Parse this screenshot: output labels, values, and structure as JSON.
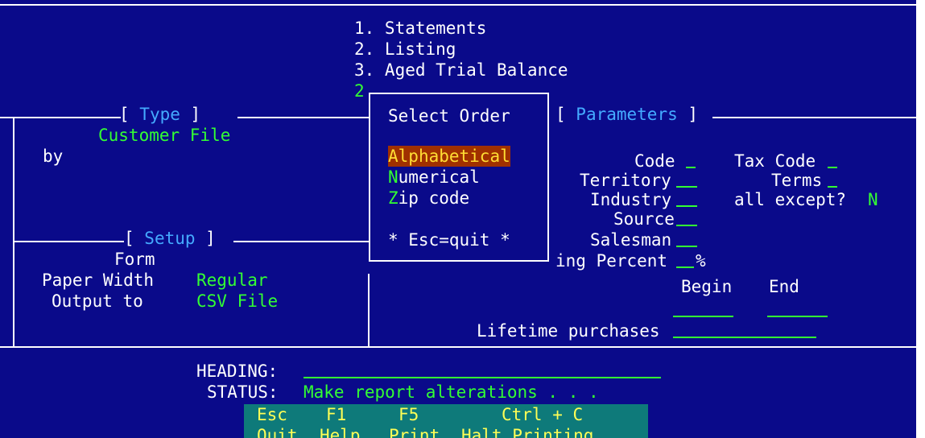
{
  "report_menu": {
    "items": [
      "1. Statements",
      "2. Listing",
      "3. Aged Trial Balance"
    ],
    "selection": "2"
  },
  "type_panel": {
    "title": "Type",
    "value": "Customer File",
    "by_label": "by"
  },
  "select_order": {
    "title": "Select Order",
    "options": [
      {
        "hotkey": "A",
        "rest": "lphabetical",
        "selected": true
      },
      {
        "hotkey": "N",
        "rest": "umerical",
        "selected": false
      },
      {
        "hotkey": "Z",
        "rest": "ip code",
        "selected": false
      }
    ],
    "quit_hint": "* Esc=quit *"
  },
  "parameters_panel": {
    "title": "Parameters",
    "code_label": "Code",
    "tax_code_label": "Tax Code",
    "territory_label": "Territory",
    "terms_label": "Terms",
    "industry_label": "Industry",
    "all_except_label": "all except?",
    "all_except_value": "N",
    "source_label": "Source",
    "salesman_label": "Salesman",
    "percent_label": "ing Percent",
    "percent_sign": "%",
    "begin_label": "Begin",
    "end_label": "End",
    "lifetime_label": "Lifetime purchases"
  },
  "setup_panel": {
    "title": "Setup",
    "form_label": "Form",
    "paper_width_label": "Paper Width",
    "paper_width_value": "Regular",
    "output_label": "Output to",
    "output_value": "CSV File"
  },
  "footer": {
    "heading_label": "HEADING:",
    "status_label": "STATUS:",
    "status_value": "Make report alterations . . ."
  },
  "function_keys": [
    {
      "key": "Esc",
      "action": "Quit"
    },
    {
      "key": "F1",
      "action": "Help"
    },
    {
      "key": "F5",
      "action": "Print"
    },
    {
      "key": "Ctrl + C",
      "action": "Halt Printing"
    }
  ],
  "colors": {
    "background": "#0a0a8a",
    "text": "#ffffff",
    "value": "#33ff33",
    "title": "#44aaff",
    "highlight_bg": "#a03000",
    "highlight_fg": "#ffdd33",
    "fkey_bar": "#0e7a7a"
  }
}
